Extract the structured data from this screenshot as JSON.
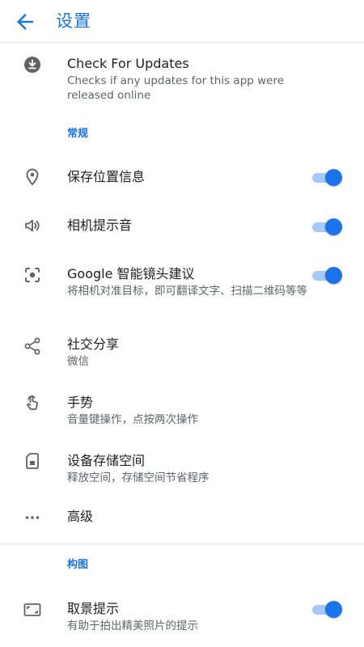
{
  "header": {
    "title": "设置",
    "back_icon": "arrow-back-icon"
  },
  "colors": {
    "accent": "#1a73e8",
    "toggle_track": "#a6c8fb",
    "text_primary": "#202124",
    "text_secondary": "#5f6368"
  },
  "update": {
    "title": "Check For Updates",
    "subtitle": "Checks if any updates for this app were released online",
    "icon": "download-icon"
  },
  "sections": {
    "general": "常规",
    "composition": "构图"
  },
  "settings": {
    "save_location": {
      "title": "保存位置信息",
      "icon": "location-pin-icon",
      "enabled": true
    },
    "camera_sound": {
      "title": "相机提示音",
      "icon": "speaker-icon",
      "enabled": true
    },
    "google_lens": {
      "title": "Google 智能镜头建议",
      "subtitle": "将相机对准目标，即可翻译文字、扫描二维码等等",
      "icon": "lens-icon",
      "enabled": true
    },
    "social_share": {
      "title": "社交分享",
      "subtitle": "微信",
      "icon": "share-icon"
    },
    "gestures": {
      "title": "手势",
      "subtitle": "音量键操作，点按两次操作",
      "icon": "gesture-hand-icon"
    },
    "storage": {
      "title": "设备存储空间",
      "subtitle": "释放空间，存储空间节省程序",
      "icon": "sd-card-icon"
    },
    "advanced": {
      "title": "高级",
      "icon": "more-horiz-icon"
    },
    "framing_hints": {
      "title": "取景提示",
      "subtitle": "有助于拍出精美照片的提示",
      "icon": "frame-icon",
      "enabled": true
    }
  }
}
